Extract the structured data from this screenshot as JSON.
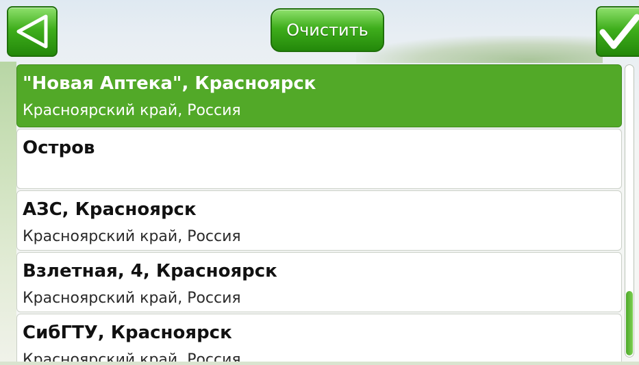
{
  "toolbar": {
    "back_icon": "triangle-left-icon",
    "clear_label": "Очистить",
    "confirm_icon": "checkmark-icon"
  },
  "colors": {
    "accent": "#52a928",
    "button_dark": "#23880a",
    "button_light": "#8ee06c"
  },
  "results": [
    {
      "title": "\"Новая Аптека\", Красноярск",
      "subtitle": "Красноярский край, Россия",
      "selected": true
    },
    {
      "title": "Остров",
      "subtitle": "",
      "selected": false
    },
    {
      "title": "АЗС, Красноярск",
      "subtitle": "Красноярский край, Россия",
      "selected": false
    },
    {
      "title": "Взлетная, 4, Красноярск",
      "subtitle": "Красноярский край, Россия",
      "selected": false
    },
    {
      "title": "СибГТУ, Красноярск",
      "subtitle": "Красноярский край, Россия",
      "selected": false
    }
  ]
}
